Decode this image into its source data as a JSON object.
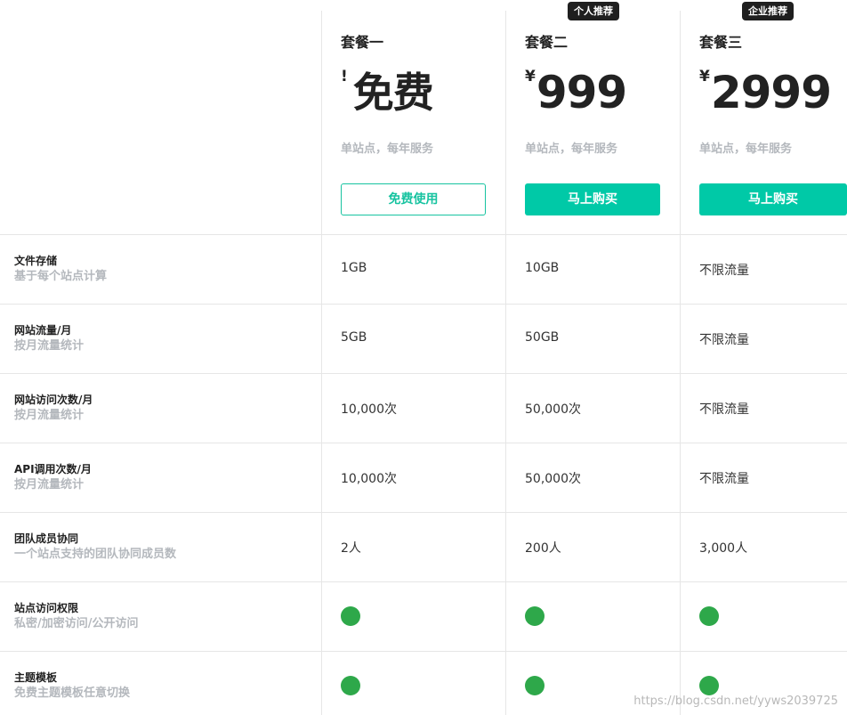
{
  "plans": [
    {
      "name": "套餐一",
      "badge": "",
      "currency": "!",
      "price": "免费",
      "subtitle": "单站点，每年服务",
      "button": "免费使用"
    },
    {
      "name": "套餐二",
      "badge": "个人推荐",
      "currency": "¥",
      "price": "999",
      "subtitle": "单站点，每年服务",
      "button": "马上购买"
    },
    {
      "name": "套餐三",
      "badge": "企业推荐",
      "currency": "¥",
      "price": "2999",
      "subtitle": "单站点，每年服务",
      "button": "马上购买"
    }
  ],
  "features": [
    {
      "title": "文件存储",
      "desc": "基于每个站点计算",
      "values": [
        "1GB",
        "10GB",
        "不限流量"
      ]
    },
    {
      "title": "网站流量/月",
      "desc": "按月流量统计",
      "values": [
        "5GB",
        "50GB",
        "不限流量"
      ]
    },
    {
      "title": "网站访问次数/月",
      "desc": "按月流量统计",
      "values": [
        "10,000次",
        "50,000次",
        "不限流量"
      ]
    },
    {
      "title": "API调用次数/月",
      "desc": "按月流量统计",
      "values": [
        "10,000次",
        "50,000次",
        "不限流量"
      ]
    },
    {
      "title": "团队成员协同",
      "desc": "一个站点支持的团队协同成员数",
      "values": [
        "2人",
        "200人",
        "3,000人"
      ]
    },
    {
      "title": "站点访问权限",
      "desc": "私密/加密访问/公开访问",
      "values": [
        "included",
        "included",
        "included"
      ]
    },
    {
      "title": "主题模板",
      "desc": "免费主题模板任意切换",
      "values": [
        "included",
        "included",
        "included"
      ]
    }
  ],
  "colors": {
    "accent": "#00c9a7",
    "included_dot": "#2ea84a",
    "muted_text": "#b4b8bd",
    "divider": "#e6e6e6"
  },
  "icons": {
    "included": "check-dot-icon"
  },
  "watermark": "https://blog.csdn.net/yyws2039725"
}
